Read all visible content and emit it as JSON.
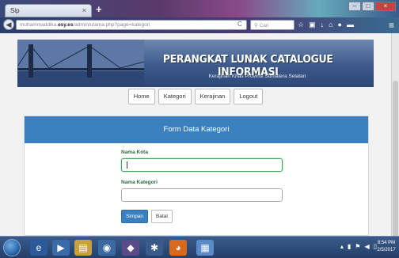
{
  "browser": {
    "tab_title": "Sip",
    "tab_close": "×",
    "new_tab": "+",
    "url_prefix": "muhammaddika.",
    "url_domain": "esy.es",
    "url_path": "/admin/utama.php?page=kategori",
    "search_placeholder": "Cari",
    "window_buttons": [
      "–",
      "□",
      "×"
    ],
    "back": "◀",
    "reload": "C",
    "menu_icon": "≡"
  },
  "header": {
    "title": "PERANGKAT LUNAK CATALOGUE INFORMASI",
    "subtitle": "Kerajinan Khas Provinsi Sumatera Selatan"
  },
  "nav": {
    "items": [
      "Home",
      "Kategori",
      "Kerajinan",
      "Logout"
    ]
  },
  "form": {
    "heading": "Form Data Kategori",
    "city_label": "Nama Kota",
    "city_value": "",
    "category_label": "Nama Kategori",
    "category_value": "",
    "save_label": "Simpan",
    "cancel_label": "Batal"
  },
  "taskbar": {
    "time": "8:54 PM",
    "date": "2/5/2017"
  },
  "colors": {
    "panel_header": "#3a7fbe",
    "banner": "#3d5a8c",
    "field_focus": "#4aa060"
  }
}
